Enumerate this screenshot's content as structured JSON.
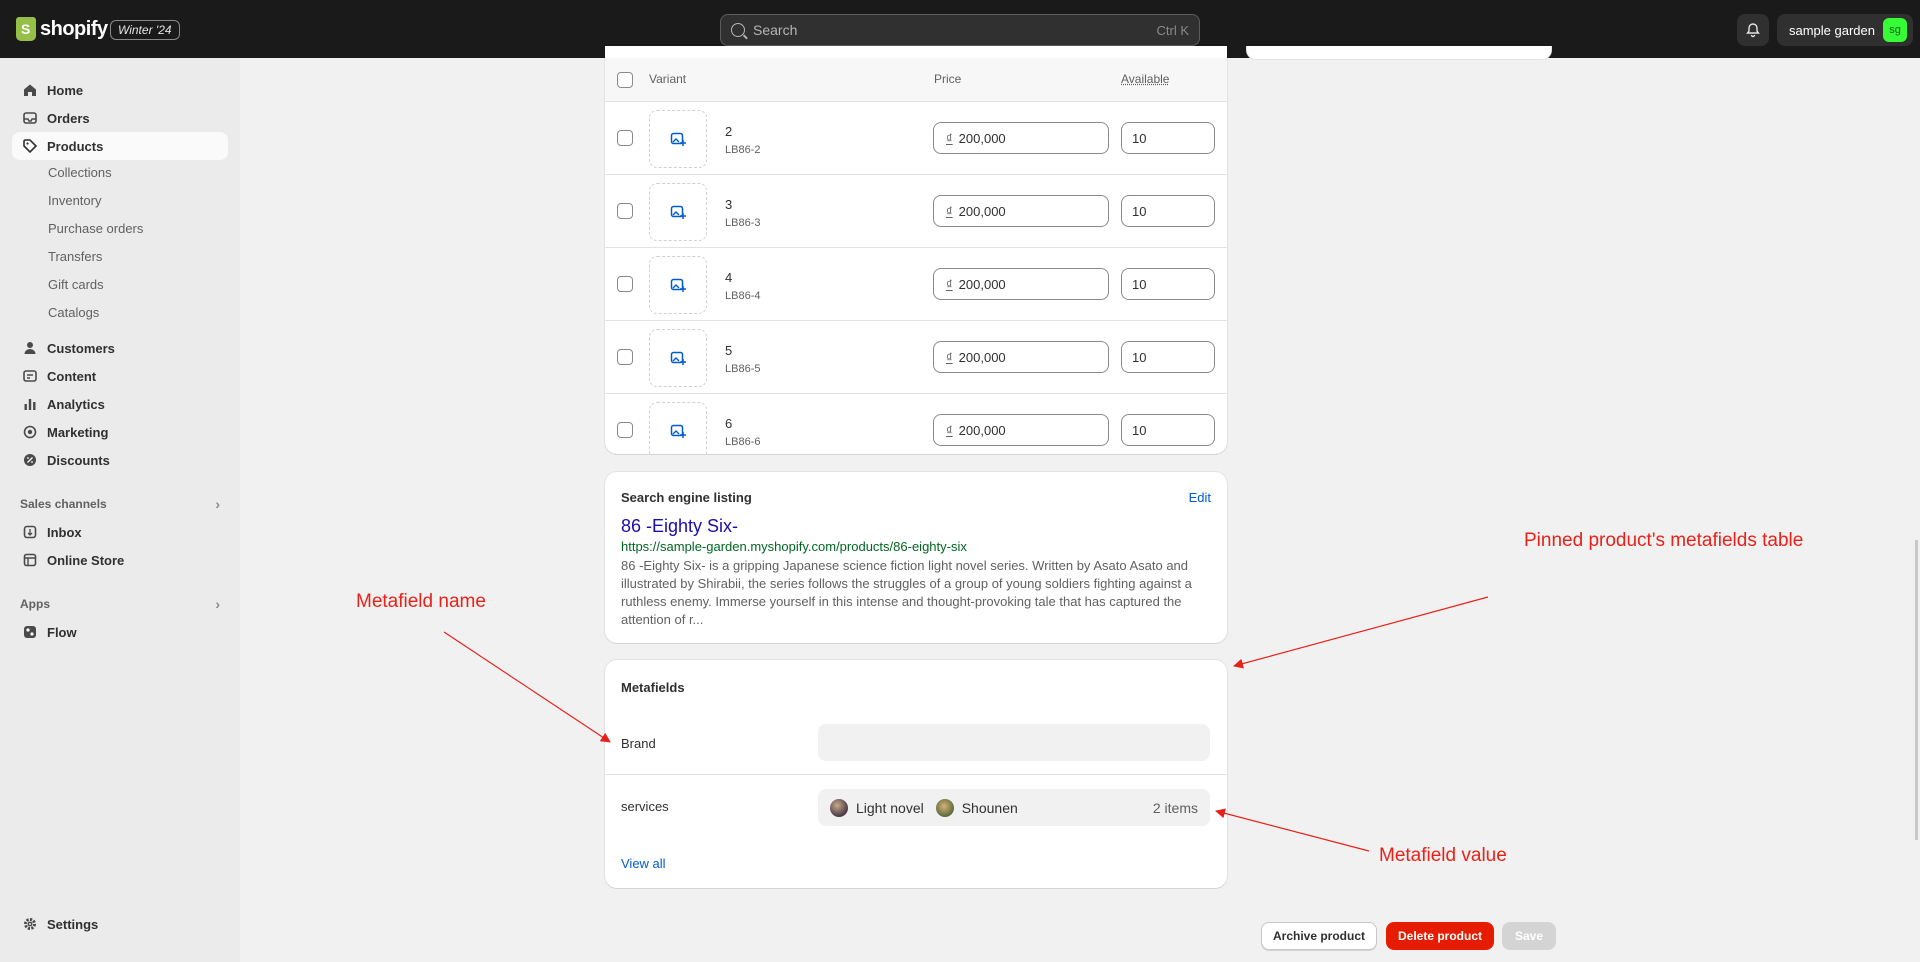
{
  "topbar": {
    "logo_text": "shopify",
    "edition": "Winter '24",
    "search_placeholder": "Search",
    "search_shortcut": "Ctrl K",
    "store_name": "sample garden",
    "store_initials": "sg"
  },
  "sidebar": {
    "main_items": [
      {
        "label": "Home",
        "icon": "home-icon"
      },
      {
        "label": "Orders",
        "icon": "inbox-tray-icon"
      },
      {
        "label": "Products",
        "icon": "tag-icon",
        "active": true
      }
    ],
    "product_subitems": [
      "Collections",
      "Inventory",
      "Purchase orders",
      "Transfers",
      "Gift cards",
      "Catalogs"
    ],
    "secondary_items": [
      {
        "label": "Customers",
        "icon": "person-icon"
      },
      {
        "label": "Content",
        "icon": "content-icon"
      },
      {
        "label": "Analytics",
        "icon": "bar-chart-icon"
      },
      {
        "label": "Marketing",
        "icon": "target-icon"
      },
      {
        "label": "Discounts",
        "icon": "discount-icon"
      }
    ],
    "sales_channels_title": "Sales channels",
    "sales_channels": [
      {
        "label": "Inbox",
        "icon": "inbox-icon"
      },
      {
        "label": "Online Store",
        "icon": "store-icon"
      }
    ],
    "apps_title": "Apps",
    "apps": [
      {
        "label": "Flow",
        "icon": "flow-icon"
      }
    ],
    "settings_label": "Settings"
  },
  "variants": {
    "headers": {
      "variant": "Variant",
      "price": "Price",
      "available": "Available"
    },
    "currency_symbol": "₫",
    "rows": [
      {
        "name": "2",
        "sku": "LB86-2",
        "price": "200,000",
        "available": "10"
      },
      {
        "name": "3",
        "sku": "LB86-3",
        "price": "200,000",
        "available": "10"
      },
      {
        "name": "4",
        "sku": "LB86-4",
        "price": "200,000",
        "available": "10"
      },
      {
        "name": "5",
        "sku": "LB86-5",
        "price": "200,000",
        "available": "10"
      },
      {
        "name": "6",
        "sku": "LB86-6",
        "price": "200,000",
        "available": "10"
      }
    ]
  },
  "seo": {
    "title": "Search engine listing",
    "edit_label": "Edit",
    "page_title": "86 -Eighty Six-",
    "url": "https://sample-garden.myshopify.com/products/86-eighty-six",
    "description": "86 -Eighty Six- is a gripping Japanese science fiction light novel series. Written by Asato Asato and illustrated by Shirabii, the series follows the struggles of a group of young soldiers fighting against a ruthless enemy. Immerse yourself in this intense and thought-provoking tale that has captured the attention of r..."
  },
  "metafields": {
    "title": "Metafields",
    "rows": [
      {
        "label": "Brand",
        "value": ""
      },
      {
        "label": "services",
        "items": [
          "Light novel",
          "Shounen"
        ],
        "count_text": "2 items"
      }
    ],
    "view_all": "View all"
  },
  "footer": {
    "archive": "Archive product",
    "delete": "Delete product",
    "save": "Save"
  },
  "annotations": {
    "metafield_name": "Metafield name",
    "metafields_table": "Pinned product's metafields table",
    "metafield_value": "Metafield value"
  },
  "colors": {
    "annotation": "#e8221a",
    "delete": "#e51c00",
    "link": "#005bd3"
  }
}
